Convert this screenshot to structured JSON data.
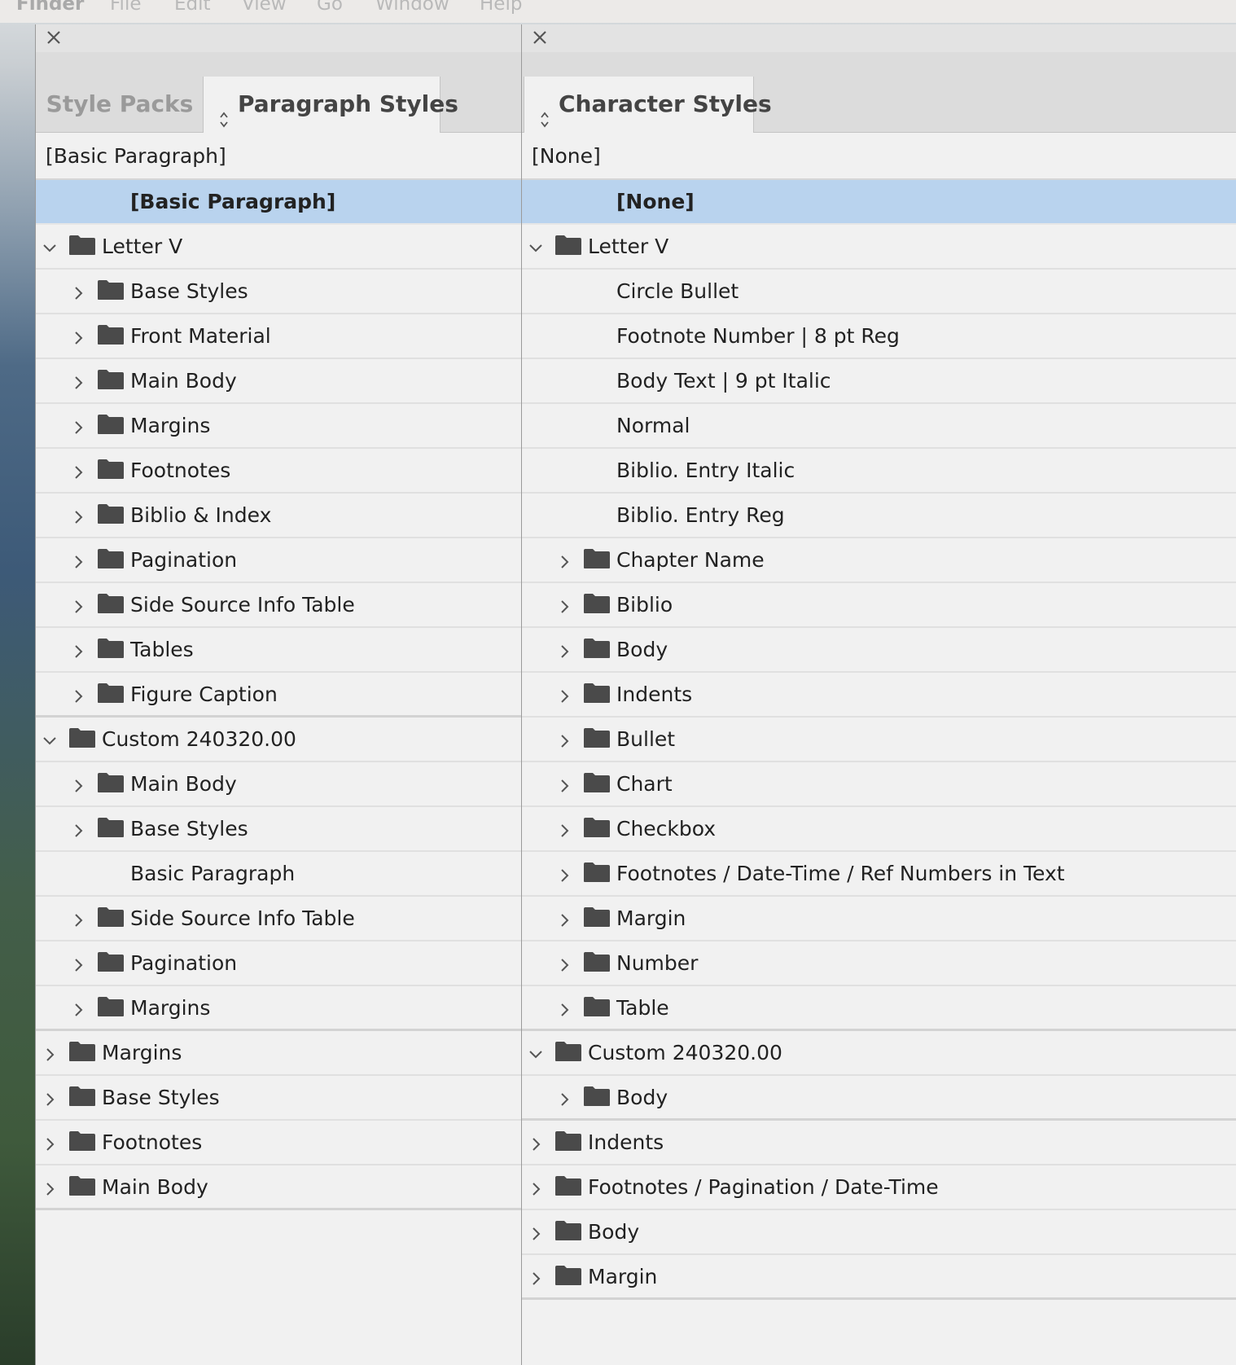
{
  "menubar": {
    "app": "Finder",
    "items": [
      "File",
      "Edit",
      "View",
      "Go",
      "Window",
      "Help"
    ]
  },
  "left_panel": {
    "tabs": [
      {
        "label": "Style Packs",
        "active": false
      },
      {
        "label": "Paragraph Styles",
        "active": true
      }
    ],
    "current_style": "[Basic Paragraph]",
    "rows": [
      {
        "label": "[Basic Paragraph]",
        "level": 1,
        "type": "style",
        "selected": true
      },
      {
        "label": "Letter V",
        "level": 0,
        "type": "folder",
        "expanded": true
      },
      {
        "label": "Base Styles",
        "level": 1,
        "type": "folder",
        "expanded": false
      },
      {
        "label": "Front Material",
        "level": 1,
        "type": "folder",
        "expanded": false
      },
      {
        "label": "Main Body",
        "level": 1,
        "type": "folder",
        "expanded": false
      },
      {
        "label": "Margins",
        "level": 1,
        "type": "folder",
        "expanded": false
      },
      {
        "label": "Footnotes",
        "level": 1,
        "type": "folder",
        "expanded": false
      },
      {
        "label": "Biblio & Index",
        "level": 1,
        "type": "folder",
        "expanded": false
      },
      {
        "label": "Pagination",
        "level": 1,
        "type": "folder",
        "expanded": false
      },
      {
        "label": "Side Source Info Table",
        "level": 1,
        "type": "folder",
        "expanded": false
      },
      {
        "label": "Tables",
        "level": 1,
        "type": "folder",
        "expanded": false
      },
      {
        "label": "Figure Caption",
        "level": 1,
        "type": "folder",
        "expanded": false,
        "section_end": true
      },
      {
        "label": "Custom 240320.00",
        "level": 0,
        "type": "folder",
        "expanded": true
      },
      {
        "label": "Main Body",
        "level": 1,
        "type": "folder",
        "expanded": false
      },
      {
        "label": "Base Styles",
        "level": 1,
        "type": "folder",
        "expanded": false
      },
      {
        "label": "Basic Paragraph",
        "level": 1,
        "type": "style"
      },
      {
        "label": "Side Source Info Table",
        "level": 1,
        "type": "folder",
        "expanded": false
      },
      {
        "label": "Pagination",
        "level": 1,
        "type": "folder",
        "expanded": false
      },
      {
        "label": "Margins",
        "level": 1,
        "type": "folder",
        "expanded": false,
        "section_end": true
      },
      {
        "label": "Margins",
        "level": 0,
        "type": "folder",
        "expanded": false
      },
      {
        "label": "Base Styles",
        "level": 0,
        "type": "folder",
        "expanded": false
      },
      {
        "label": "Footnotes",
        "level": 0,
        "type": "folder",
        "expanded": false
      },
      {
        "label": "Main Body",
        "level": 0,
        "type": "folder",
        "expanded": false,
        "section_end": true
      }
    ]
  },
  "right_panel": {
    "tabs": [
      {
        "label": "Character Styles",
        "active": true
      }
    ],
    "current_style": "[None]",
    "rows": [
      {
        "label": "[None]",
        "level": 1,
        "type": "style",
        "selected": true
      },
      {
        "label": "Letter V",
        "level": 0,
        "type": "folder",
        "expanded": true
      },
      {
        "label": "Circle Bullet",
        "level": 1,
        "type": "style"
      },
      {
        "label": "Footnote Number | 8 pt Reg",
        "level": 1,
        "type": "style"
      },
      {
        "label": "Body Text | 9 pt Italic",
        "level": 1,
        "type": "style"
      },
      {
        "label": "Normal",
        "level": 1,
        "type": "style"
      },
      {
        "label": "Biblio. Entry Italic",
        "level": 1,
        "type": "style"
      },
      {
        "label": "Biblio. Entry Reg",
        "level": 1,
        "type": "style"
      },
      {
        "label": "Chapter Name",
        "level": 1,
        "type": "folder",
        "expanded": false
      },
      {
        "label": "Biblio",
        "level": 1,
        "type": "folder",
        "expanded": false
      },
      {
        "label": "Body",
        "level": 1,
        "type": "folder",
        "expanded": false
      },
      {
        "label": "Indents",
        "level": 1,
        "type": "folder",
        "expanded": false
      },
      {
        "label": "Bullet",
        "level": 1,
        "type": "folder",
        "expanded": false
      },
      {
        "label": "Chart",
        "level": 1,
        "type": "folder",
        "expanded": false
      },
      {
        "label": "Checkbox",
        "level": 1,
        "type": "folder",
        "expanded": false
      },
      {
        "label": "Footnotes / Date-Time / Ref Numbers in Text",
        "level": 1,
        "type": "folder",
        "expanded": false
      },
      {
        "label": "Margin",
        "level": 1,
        "type": "folder",
        "expanded": false
      },
      {
        "label": "Number",
        "level": 1,
        "type": "folder",
        "expanded": false
      },
      {
        "label": "Table",
        "level": 1,
        "type": "folder",
        "expanded": false,
        "section_end": true
      },
      {
        "label": "Custom 240320.00",
        "level": 0,
        "type": "folder",
        "expanded": true
      },
      {
        "label": "Body",
        "level": 1,
        "type": "folder",
        "expanded": false,
        "section_end": true
      },
      {
        "label": "Indents",
        "level": 0,
        "type": "folder",
        "expanded": false
      },
      {
        "label": "Footnotes / Pagination / Date-Time",
        "level": 0,
        "type": "folder",
        "expanded": false
      },
      {
        "label": "Body",
        "level": 0,
        "type": "folder",
        "expanded": false
      },
      {
        "label": "Margin",
        "level": 0,
        "type": "folder",
        "expanded": false,
        "section_end": true
      }
    ]
  },
  "icons": {
    "close": "close-icon",
    "folder": "folder-icon",
    "expand": "chevron-right-icon",
    "collapse": "chevron-down-icon",
    "tab_menu": "up-down-arrows-icon"
  },
  "colors": {
    "selection": "#b9d3ee",
    "panel_bg": "#f1f1f1",
    "tab_strip": "#dcdcdc",
    "folder": "#4a4a4a"
  }
}
